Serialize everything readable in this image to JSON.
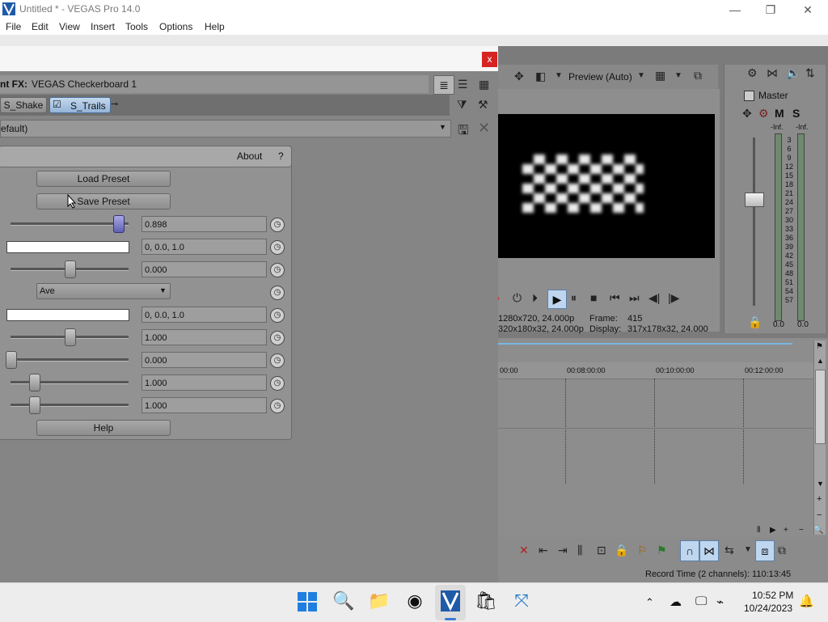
{
  "app": {
    "window_title": "Untitled * - VEGAS Pro 14.0",
    "controls": {
      "minimize": "—",
      "maximize": "❐",
      "close": "✕"
    }
  },
  "menu": [
    "File",
    "Edit",
    "View",
    "Insert",
    "Tools",
    "Options",
    "Help"
  ],
  "fx_dialog": {
    "close_label": "x",
    "header_label": "nt FX:",
    "header_name": "VEGAS Checkerboard 1",
    "chain": [
      {
        "label": "S_Shake"
      },
      {
        "label": "S_Trails"
      }
    ],
    "preset_value": "efault)",
    "about_label": "About",
    "help_q": "?",
    "load_preset": "Load Preset",
    "save_preset": "Save Preset",
    "help_button": "Help",
    "params": [
      {
        "type": "slider",
        "value": "0.898",
        "level": 0.898
      },
      {
        "type": "color",
        "value": "0, 0.0, 1.0"
      },
      {
        "type": "slider",
        "value": "0.000",
        "level": 0.5
      },
      {
        "type": "select",
        "value": "Ave"
      },
      {
        "type": "color",
        "value": "0, 0.0, 1.0"
      },
      {
        "type": "slider",
        "value": "1.000",
        "level": 0.5
      },
      {
        "type": "slider",
        "value": "0.000",
        "level": 0.0
      },
      {
        "type": "slider",
        "value": "1.000",
        "level": 0.2
      },
      {
        "type": "slider",
        "value": "1.000",
        "level": 0.2
      }
    ]
  },
  "preview": {
    "mode_label": "Preview (Auto)",
    "project_label": "1280x720, 24.000p",
    "preview_label": "320x180x32, 24.000p",
    "frame_label": "Frame:",
    "frame_value": "415",
    "display_label": "Display:",
    "display_value": "317x178x32, 24.000"
  },
  "mixer": {
    "title": "Master",
    "m": "M",
    "s": "S",
    "inf_left": "-Inf.",
    "inf_right": "-Inf.",
    "scale": [
      "3",
      "6",
      "9",
      "12",
      "15",
      "18",
      "21",
      "24",
      "27",
      "30",
      "33",
      "36",
      "39",
      "42",
      "45",
      "48",
      "51",
      "54",
      "57"
    ],
    "level_left": "0.0",
    "level_right": "0.0"
  },
  "timeline": {
    "ruler": [
      "00:00",
      "00:08:00:00",
      "00:10:00:00",
      "00:12:00:00"
    ]
  },
  "status": {
    "record_time": "Record Time (2 channels): 110:13:45"
  },
  "taskbar": {
    "time": "10:52 PM",
    "date": "10/24/2023"
  },
  "colors": {
    "accent": "#3c7bd6",
    "close_red": "#d72323"
  }
}
